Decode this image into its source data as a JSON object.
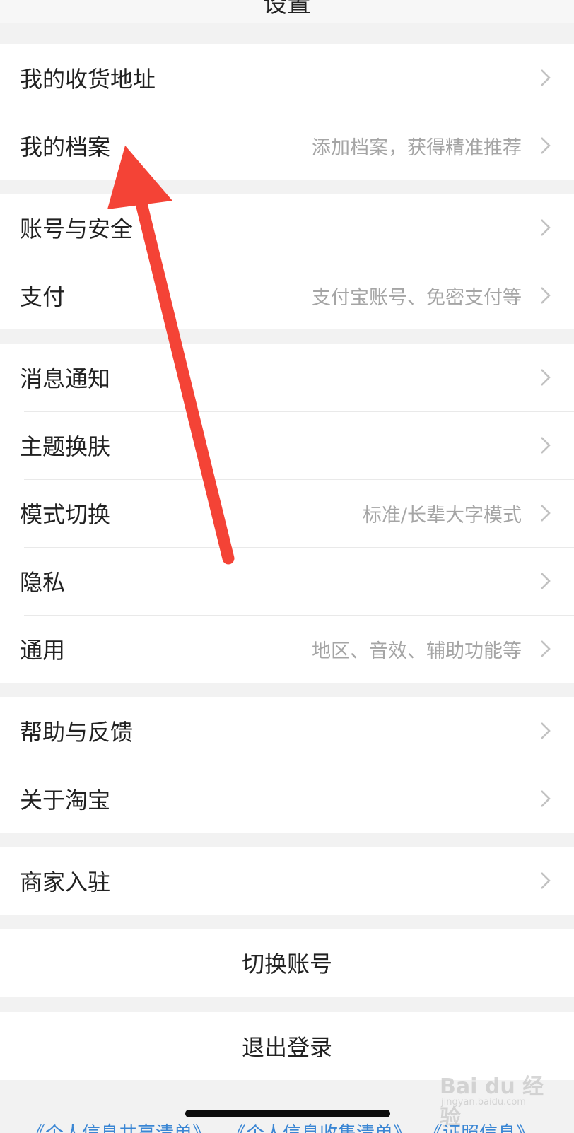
{
  "header": {
    "title": "设置"
  },
  "groups": [
    {
      "items": [
        {
          "label": "我的收货地址",
          "hint": ""
        },
        {
          "label": "我的档案",
          "hint": "添加档案，获得精准推荐"
        }
      ]
    },
    {
      "items": [
        {
          "label": "账号与安全",
          "hint": ""
        },
        {
          "label": "支付",
          "hint": "支付宝账号、免密支付等"
        }
      ]
    },
    {
      "items": [
        {
          "label": "消息通知",
          "hint": ""
        },
        {
          "label": "主题换肤",
          "hint": ""
        },
        {
          "label": "模式切换",
          "hint": "标准/长辈大字模式"
        },
        {
          "label": "隐私",
          "hint": ""
        },
        {
          "label": "通用",
          "hint": "地区、音效、辅助功能等"
        }
      ]
    },
    {
      "items": [
        {
          "label": "帮助与反馈",
          "hint": ""
        },
        {
          "label": "关于淘宝",
          "hint": ""
        }
      ]
    },
    {
      "items": [
        {
          "label": "商家入驻",
          "hint": ""
        }
      ]
    }
  ],
  "actions": {
    "switch_account": "切换账号",
    "logout": "退出登录"
  },
  "footer": {
    "links": [
      "《个人信息共享清单》",
      "《个人信息收集清单》",
      "《证照信息》"
    ]
  },
  "watermark": {
    "text": "Bai du 经验",
    "sub": "jingyan.baidu.com"
  },
  "colors": {
    "annotation_arrow": "#f44336",
    "link": "#3a86d4",
    "hint_text": "#a5a5a5"
  },
  "icons": {
    "row_chevron": "chevron-right-icon"
  }
}
